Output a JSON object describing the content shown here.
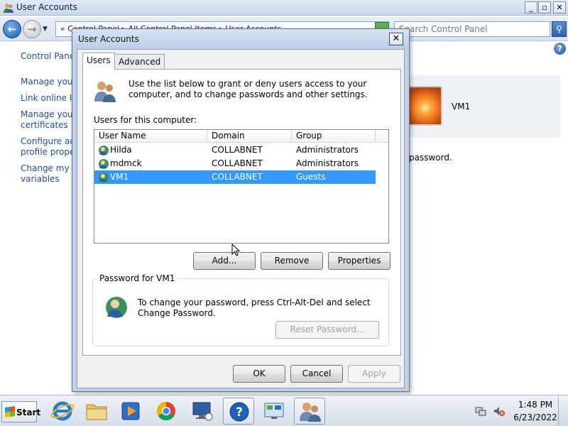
{
  "background_window": {
    "title": "User Accounts",
    "caption_buttons": {
      "minimize": "_",
      "maximize": "▫",
      "close": "✕"
    },
    "address_text": "« Control Panel ▸ All Control Panel Items ▸ User Accounts",
    "search_placeholder": "Search Control Panel",
    "left_links": [
      "Control Panel",
      "Manage your",
      "Link online ID",
      "Manage your",
      "certificates",
      "Configure adv",
      "profile proper",
      "Change my e",
      "variables"
    ],
    "user_name": "VM1",
    "password_text": "password."
  },
  "dialog": {
    "title": "User Accounts",
    "close_label": "✕",
    "tabs": [
      {
        "label": "Users",
        "selected": true
      },
      {
        "label": "Advanced",
        "selected": false
      }
    ],
    "intro_text": "Use the list below to grant or deny users access to your computer, and to change passwords and other settings.",
    "users_label": "Users for this computer:",
    "columns": [
      "User Name",
      "Domain",
      "Group"
    ],
    "users": [
      {
        "name": "Hilda",
        "domain": "COLLABNET",
        "group": "Administrators",
        "selected": false
      },
      {
        "name": "mdmck",
        "domain": "COLLABNET",
        "group": "Administrators",
        "selected": false
      },
      {
        "name": "VM1",
        "domain": "COLLABNET",
        "group": "Guests",
        "selected": true
      }
    ],
    "buttons": {
      "add": "Add...",
      "remove": "Remove",
      "properties": "Properties"
    },
    "password_group": {
      "legend": "Password for VM1",
      "text": "To change your password, press Ctrl-Alt-Del and select Change Password.",
      "reset_button": "Reset Password..."
    },
    "footer": {
      "ok": "OK",
      "cancel": "Cancel",
      "apply": "Apply"
    }
  },
  "taskbar": {
    "start_label": "Start",
    "pinned": [
      "internet-explorer-icon",
      "windows-explorer-icon",
      "media-player-icon",
      "chrome-icon",
      "remote-desktop-icon",
      "help-icon",
      "control-panel-icon",
      "user-accounts-icon"
    ],
    "time": "1:48 PM",
    "date": "6/23/2022"
  },
  "colors": {
    "selection": "#3399ff",
    "link": "#1c4f9c",
    "dialog_frame": "#bfd0e7"
  }
}
